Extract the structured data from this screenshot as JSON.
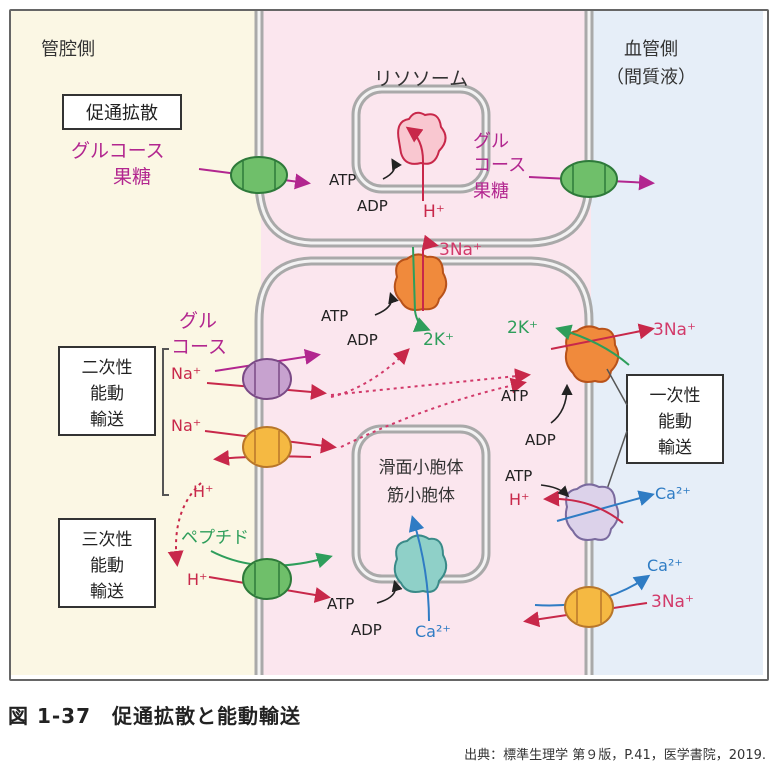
{
  "regions": {
    "lumen": "管腔側",
    "blood": "血管側",
    "blood_sub": "（間質液）"
  },
  "organelles": {
    "lysosome": "リソソーム",
    "er_line1": "滑面小胞体",
    "er_line2": "筋小胞体"
  },
  "boxes": {
    "facilitated": "促通拡散",
    "secondary": [
      "二次性",
      "能動",
      "輸送"
    ],
    "tertiary": [
      "三次性",
      "能動",
      "輸送"
    ],
    "primary": [
      "一次性",
      "能動",
      "輸送"
    ]
  },
  "labels": {
    "glucose_left": "グルコース",
    "fructose_left": "果糖",
    "glucose_mid": [
      "グル",
      "コース",
      "果糖"
    ],
    "glucose_sec": [
      "グル",
      "コース"
    ],
    "na_plus": "Na⁺",
    "h_plus": "H⁺",
    "peptide": "ペプチド",
    "atp": "ATP",
    "adp": "ADP",
    "three_na": "3Na⁺",
    "two_k": "2K⁺",
    "ca": "Ca²⁺"
  },
  "colors": {
    "lumen_bg": "#fbf7e4",
    "cell_bg": "#fbe6ee",
    "blood_bg": "#e6eef8",
    "membrane": "#a9a9a9",
    "magenta": "#b2268f",
    "red": "#c8284a",
    "green": "#2e9e5b",
    "blue": "#2f7cc4",
    "orange": "#f08a3c",
    "yellow": "#f5b942"
  },
  "caption": "図 1-37　促通拡散と能動輸送",
  "source": "出典：標準生理学 第９版，P.41，医学書院，2019."
}
